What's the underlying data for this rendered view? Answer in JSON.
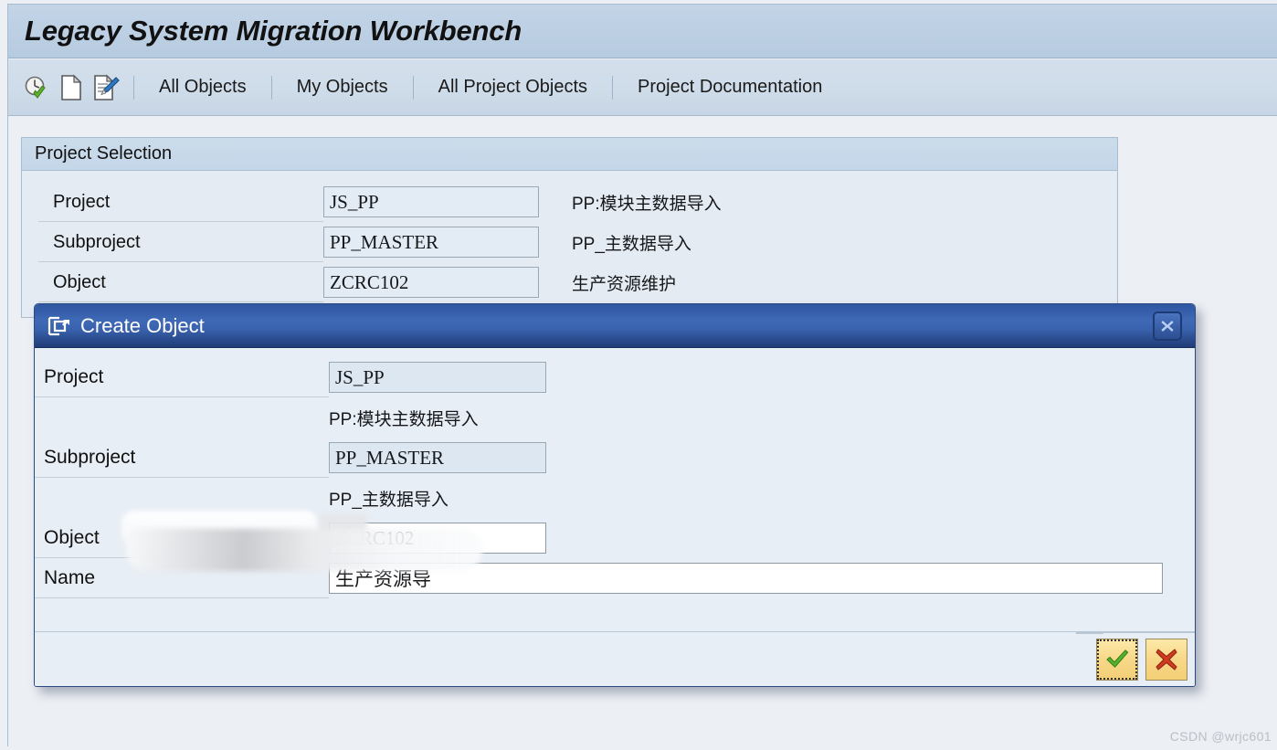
{
  "window": {
    "title": "Legacy System Migration Workbench"
  },
  "toolbar": {
    "icons": [
      {
        "name": "execute-check-icon",
        "label": "Execute"
      },
      {
        "name": "new-document-icon",
        "label": "Create"
      },
      {
        "name": "edit-document-icon",
        "label": "Change"
      }
    ],
    "items": [
      {
        "label": "All Objects"
      },
      {
        "label": "My Objects"
      },
      {
        "label": "All Project Objects"
      },
      {
        "label": "Project Documentation"
      }
    ]
  },
  "panel": {
    "header": "Project Selection",
    "rows": [
      {
        "label": "Project",
        "value": "JS_PP",
        "description": "PP:模块主数据导入"
      },
      {
        "label": "Subproject",
        "value": "PP_MASTER",
        "description": "PP_主数据导入"
      },
      {
        "label": "Object",
        "value": "ZCRC102",
        "description": "生产资源维护"
      }
    ]
  },
  "dialog": {
    "title": "Create Object",
    "icon_name": "create-object-icon",
    "close_label": "✖",
    "fields": {
      "project_label": "Project",
      "project_value": "JS_PP",
      "project_desc": "PP:模块主数据导入",
      "subproject_label": "Subproject",
      "subproject_value": "PP_MASTER",
      "subproject_desc": "PP_主数据导入",
      "object_label": "Object",
      "object_value": "ZCRC102",
      "name_label": "Name",
      "name_value": "生产资源导"
    },
    "buttons": {
      "confirm_label": "✔",
      "cancel_label": "✖"
    }
  },
  "watermark": "CSDN @wrjc601",
  "colors": {
    "banner_blue": "#bdd0e4",
    "toolbar_blue": "#cfdce9",
    "panel_header": "#c4d6e8",
    "dialog_title": "#3f69b6",
    "dialog_border": "#2b4a84",
    "field_readonly": "#dce7f1",
    "button_yellow": "#f7d888",
    "check_green": "#4a9c2e",
    "cross_red": "#c3331f"
  }
}
